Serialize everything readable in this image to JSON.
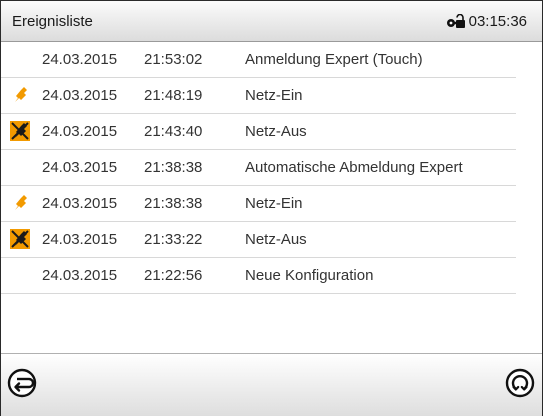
{
  "header": {
    "title": "Ereignisliste",
    "clock": "03:15:36"
  },
  "events": [
    {
      "icon": "none",
      "date": "24.03.2015",
      "time": "21:53:02",
      "text": "Anmeldung Expert (Touch)"
    },
    {
      "icon": "power-on",
      "date": "24.03.2015",
      "time": "21:48:19",
      "text": "Netz-Ein"
    },
    {
      "icon": "power-off",
      "date": "24.03.2015",
      "time": "21:43:40",
      "text": "Netz-Aus"
    },
    {
      "icon": "none",
      "date": "24.03.2015",
      "time": "21:38:38",
      "text": "Automatische Abmeldung Expert"
    },
    {
      "icon": "power-on",
      "date": "24.03.2015",
      "time": "21:38:38",
      "text": "Netz-Ein"
    },
    {
      "icon": "power-off",
      "date": "24.03.2015",
      "time": "21:33:22",
      "text": "Netz-Aus"
    },
    {
      "icon": "none",
      "date": "24.03.2015",
      "time": "21:22:56",
      "text": "Neue Konfiguration"
    }
  ],
  "colors": {
    "icon_orange": "#f29a00",
    "icon_dark": "#1a1a1a"
  }
}
